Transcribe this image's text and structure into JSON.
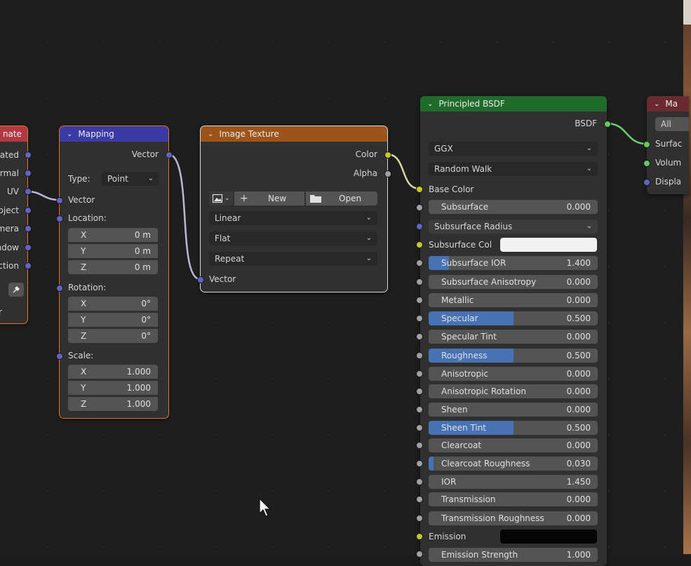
{
  "colors": {
    "mapping_header": "#3b3ba6",
    "image_texture_header": "#9c5418",
    "bsdf_header": "#1f6b2a",
    "coordinate_header": "#b03a44",
    "output_header": "#6a2a30",
    "accent": "#4772b3"
  },
  "coordinate_node": {
    "title": "nate",
    "outputs": [
      "rated",
      "rmal",
      "UV",
      "bject",
      "mera",
      "ndow",
      "ction"
    ],
    "bottom_label": "r",
    "eyedropper_icon": "eyedropper-icon"
  },
  "mapping_node": {
    "title": "Mapping",
    "output": "Vector",
    "type_label": "Type:",
    "type_value": "Point",
    "input_vector": "Vector",
    "location": {
      "label": "Location:",
      "x": "0 m",
      "y": "0 m",
      "z": "0 m"
    },
    "rotation": {
      "label": "Rotation:",
      "x": "0°",
      "y": "0°",
      "z": "0°"
    },
    "scale": {
      "label": "Scale:",
      "x": "1.000",
      "y": "1.000",
      "z": "1.000"
    },
    "axes": {
      "x": "X",
      "y": "Y",
      "z": "Z"
    }
  },
  "image_texture_node": {
    "title": "Image Texture",
    "out_color": "Color",
    "out_alpha": "Alpha",
    "new_label": "New",
    "open_label": "Open",
    "interpolation": "Linear",
    "projection": "Flat",
    "extension": "Repeat",
    "input_vector": "Vector"
  },
  "bsdf_node": {
    "title": "Principled BSDF",
    "output": "BSDF",
    "distribution": "GGX",
    "subsurface_method": "Random Walk",
    "base_color": "Base Color",
    "subsurface_radius": "Subsurface Radius",
    "subsurface_col": "Subsurface Col",
    "emission": "Emission",
    "emission_strength": "Emission Strength",
    "emission_strength_value": "1.000",
    "fields": [
      {
        "name": "Subsurface",
        "value": "0.000",
        "fill": 0
      },
      {
        "name": "Subsurface IOR",
        "value": "1.400",
        "fill": 0.12
      },
      {
        "name": "Subsurface Anisotropy",
        "value": "0.000",
        "fill": 0
      },
      {
        "name": "Metallic",
        "value": "0.000",
        "fill": 0
      },
      {
        "name": "Specular",
        "value": "0.500",
        "fill": 0.5
      },
      {
        "name": "Specular Tint",
        "value": "0.000",
        "fill": 0
      },
      {
        "name": "Roughness",
        "value": "0.500",
        "fill": 0.5
      },
      {
        "name": "Anisotropic",
        "value": "0.000",
        "fill": 0
      },
      {
        "name": "Anisotropic Rotation",
        "value": "0.000",
        "fill": 0
      },
      {
        "name": "Sheen",
        "value": "0.000",
        "fill": 0
      },
      {
        "name": "Sheen Tint",
        "value": "0.500",
        "fill": 0.5
      },
      {
        "name": "Clearcoat",
        "value": "0.000",
        "fill": 0
      },
      {
        "name": "Clearcoat Roughness",
        "value": "0.030",
        "fill": 0.03
      },
      {
        "name": "IOR",
        "value": "1.450",
        "fill": 0
      },
      {
        "name": "Transmission",
        "value": "0.000",
        "fill": 0
      },
      {
        "name": "Transmission Roughness",
        "value": "0.000",
        "fill": 0
      }
    ]
  },
  "output_node": {
    "title": "Ma",
    "target": "All",
    "inputs": [
      "Surfac",
      "Volum",
      "Displa"
    ]
  }
}
